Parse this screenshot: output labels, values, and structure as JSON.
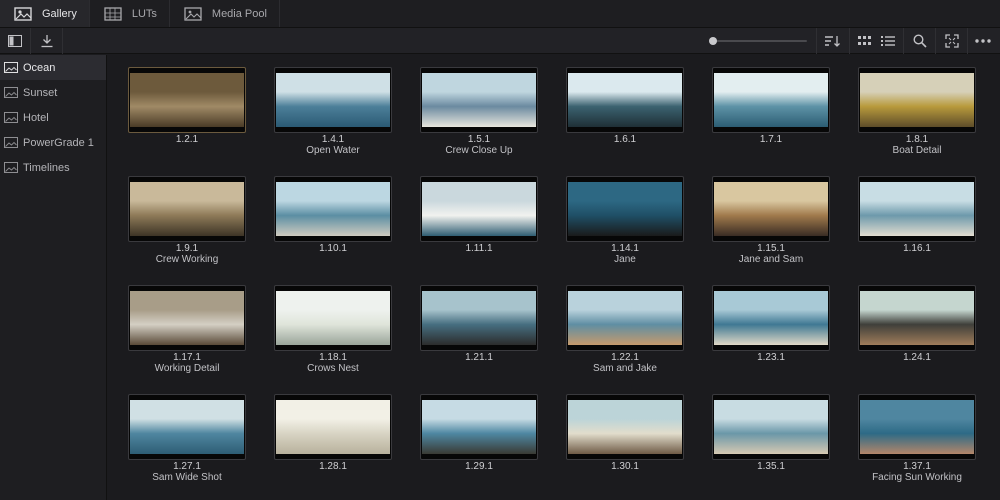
{
  "tabs": [
    {
      "label": "Gallery",
      "icon": "gallery-icon"
    },
    {
      "label": "LUTs",
      "icon": "luts-icon"
    },
    {
      "label": "Media Pool",
      "icon": "media-pool-icon"
    }
  ],
  "sidebar": {
    "items": [
      {
        "label": "Ocean",
        "active": true
      },
      {
        "label": "Sunset",
        "active": false
      },
      {
        "label": "Hotel",
        "active": false
      },
      {
        "label": "PowerGrade 1",
        "active": false
      },
      {
        "label": "Timelines",
        "active": false
      }
    ]
  },
  "toolbar": {
    "icons": [
      "sidebar-toggle-icon",
      "import-icon",
      "sort-icon",
      "grid-view-icon",
      "list-view-icon",
      "search-icon",
      "fullscreen-icon",
      "more-options-icon"
    ]
  },
  "stills": [
    {
      "id": "1.2.1",
      "name": "",
      "colors": [
        "#6d5a3c",
        "#a08a66",
        "#4a3b26"
      ]
    },
    {
      "id": "1.4.1",
      "name": "Open Water",
      "colors": [
        "#cfe0e6",
        "#4c7f99",
        "#2b5a74"
      ]
    },
    {
      "id": "1.5.1",
      "name": "Crew Close Up",
      "colors": [
        "#bfd6df",
        "#6b8aa0",
        "#e8e6de"
      ]
    },
    {
      "id": "1.6.1",
      "name": "",
      "colors": [
        "#dbe9ee",
        "#3b6270",
        "#1f2f36"
      ]
    },
    {
      "id": "1.7.1",
      "name": "",
      "colors": [
        "#e3eef0",
        "#5d92a6",
        "#2c5d73"
      ]
    },
    {
      "id": "1.8.1",
      "name": "Boat Detail",
      "colors": [
        "#d6d0b8",
        "#b89a3c",
        "#5e4d2a"
      ]
    },
    {
      "id": "1.9.1",
      "name": "Crew Working",
      "colors": [
        "#c9b99a",
        "#8e7a58",
        "#3d3426"
      ]
    },
    {
      "id": "1.10.1",
      "name": "",
      "colors": [
        "#bcd7e2",
        "#5b8ea3",
        "#cfcbbf"
      ]
    },
    {
      "id": "1.11.1",
      "name": "",
      "colors": [
        "#cad8dd",
        "#f2f2ef",
        "#2f5d72"
      ]
    },
    {
      "id": "1.14.1",
      "name": "Jane",
      "colors": [
        "#2d6883",
        "#1f4f66",
        "#1a1a1a"
      ]
    },
    {
      "id": "1.15.1",
      "name": "Jane and Sam",
      "colors": [
        "#d9c7a0",
        "#a07a4c",
        "#3a2c24"
      ]
    },
    {
      "id": "1.16.1",
      "name": "",
      "colors": [
        "#c8dde4",
        "#6d99ab",
        "#e2ddd0"
      ]
    },
    {
      "id": "1.17.1",
      "name": "Working Detail",
      "colors": [
        "#a89d88",
        "#d4cfc4",
        "#5a4a38"
      ]
    },
    {
      "id": "1.18.1",
      "name": "Crows Nest",
      "colors": [
        "#eef2ee",
        "#dfe4da",
        "#9aa59a"
      ]
    },
    {
      "id": "1.21.1",
      "name": "",
      "colors": [
        "#a7c3cc",
        "#466e80",
        "#2c2c2c"
      ]
    },
    {
      "id": "1.22.1",
      "name": "Sam and Jake",
      "colors": [
        "#b9d2dc",
        "#5f8ea3",
        "#c59a6c"
      ]
    },
    {
      "id": "1.23.1",
      "name": "",
      "colors": [
        "#a8c9d6",
        "#3f7893",
        "#e0d8c6"
      ]
    },
    {
      "id": "1.24.1",
      "name": "",
      "colors": [
        "#c5d6cf",
        "#3f3f3a",
        "#9f7d5a"
      ]
    },
    {
      "id": "1.27.1",
      "name": "Sam Wide Shot",
      "colors": [
        "#d0e0e4",
        "#4f86a0",
        "#2e5d74"
      ]
    },
    {
      "id": "1.28.1",
      "name": "",
      "colors": [
        "#f2f0e6",
        "#d8d4c4",
        "#b8b19c"
      ]
    },
    {
      "id": "1.29.1",
      "name": "",
      "colors": [
        "#c6dbe4",
        "#4e87a2",
        "#3a3a34"
      ]
    },
    {
      "id": "1.30.1",
      "name": "",
      "colors": [
        "#bcd4d8",
        "#e2ddcc",
        "#6f5b46"
      ]
    },
    {
      "id": "1.35.1",
      "name": "",
      "colors": [
        "#c8dce2",
        "#6a97a8",
        "#d6c9b2"
      ]
    },
    {
      "id": "1.37.1",
      "name": "Facing Sun Working",
      "colors": [
        "#4f86a0",
        "#2d6a86",
        "#b3866a"
      ]
    }
  ]
}
